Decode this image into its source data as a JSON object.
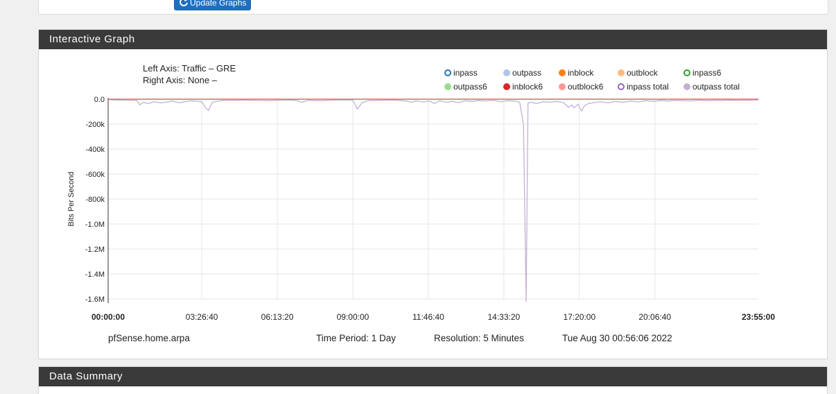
{
  "top_panel": {
    "update_button_label": "Update Graphs"
  },
  "graph_panel": {
    "title": "Interactive Graph",
    "left_axis_text": "Left Axis: Traffic – GRE",
    "right_axis_text": "Right Axis: None –",
    "legend": [
      {
        "label": "inpass",
        "color": "#1f77b4",
        "style": "hollow"
      },
      {
        "label": "outpass",
        "color": "#aec7e8",
        "style": "filled"
      },
      {
        "label": "inblock",
        "color": "#ff7f0e",
        "style": "filled"
      },
      {
        "label": "outblock",
        "color": "#ffbb78",
        "style": "filled"
      },
      {
        "label": "inpass6",
        "color": "#2ca02c",
        "style": "hollow"
      },
      {
        "label": "outpass6",
        "color": "#98df8a",
        "style": "filled"
      },
      {
        "label": "inblock6",
        "color": "#d62728",
        "style": "filled"
      },
      {
        "label": "outblock6",
        "color": "#ff9896",
        "style": "filled"
      },
      {
        "label": "inpass total",
        "color": "#9467bd",
        "style": "hollow"
      },
      {
        "label": "outpass total",
        "color": "#c5b0d5",
        "style": "filled"
      }
    ],
    "footer": {
      "host": "pfSense.home.arpa",
      "period": "Time Period: 1 Day",
      "resolution": "Resolution: 5 Minutes",
      "timestamp": "Tue Aug 30 00:56:06 2022"
    }
  },
  "summary_panel": {
    "title": "Data Summary"
  },
  "chart_data": {
    "type": "line",
    "ylabel": "Bits Per Second",
    "y_ticks": [
      {
        "value": 0,
        "label": "0.0"
      },
      {
        "value": -200000,
        "label": "-200k"
      },
      {
        "value": -400000,
        "label": "-400k"
      },
      {
        "value": -600000,
        "label": "-600k"
      },
      {
        "value": -800000,
        "label": "-800k"
      },
      {
        "value": -1000000,
        "label": "-1.0M"
      },
      {
        "value": -1200000,
        "label": "-1.2M"
      },
      {
        "value": -1400000,
        "label": "-1.4M"
      },
      {
        "value": -1600000,
        "label": "-1.6M"
      }
    ],
    "ylim": [
      -1600000,
      0
    ],
    "x_ticks": [
      {
        "value": 0,
        "label": "00:00:00",
        "bold": true
      },
      {
        "value": 12400,
        "label": "03:26:40",
        "bold": false
      },
      {
        "value": 22400,
        "label": "06:13:20",
        "bold": false
      },
      {
        "value": 32400,
        "label": "09:00:00",
        "bold": false
      },
      {
        "value": 42400,
        "label": "11:46:40",
        "bold": false
      },
      {
        "value": 52400,
        "label": "14:33:20",
        "bold": false
      },
      {
        "value": 62400,
        "label": "17:20:00",
        "bold": false
      },
      {
        "value": 72400,
        "label": "20:06:40",
        "bold": false
      },
      {
        "value": 86100,
        "label": "23:55:00",
        "bold": true
      }
    ],
    "xlim": [
      0,
      86100
    ],
    "grid": true,
    "series": [
      {
        "name": "inpass total",
        "color": "#e06666",
        "x": [
          0,
          86100
        ],
        "y": [
          0,
          0
        ]
      },
      {
        "name": "outpass total",
        "color": "#c5b0d5",
        "x": [
          0,
          2000,
          3800,
          4200,
          4700,
          5300,
          6100,
          7000,
          8500,
          9400,
          11000,
          12400,
          12900,
          13300,
          13800,
          15000,
          18000,
          21000,
          24000,
          25000,
          25600,
          26500,
          28000,
          30000,
          32400,
          33000,
          33600,
          34400,
          36000,
          38000,
          39500,
          40200,
          40800,
          41600,
          42600,
          43200,
          43900,
          44800,
          45600,
          46400,
          47300,
          48200,
          49000,
          50000,
          51000,
          52000,
          53000,
          54000,
          54500,
          55000,
          55350,
          55600,
          56000,
          56800,
          57600,
          58500,
          59400,
          60300,
          61000,
          61400,
          61700,
          62200,
          62700,
          63100,
          63600,
          64300,
          65200,
          66200,
          67200,
          68200,
          69200,
          70200,
          71200,
          72200,
          73200,
          74200,
          75200,
          76200,
          77200,
          78200,
          79200,
          80200,
          81200,
          82200,
          83200,
          84200,
          85200,
          86100
        ],
        "y": [
          -5000,
          -8000,
          -10000,
          -45000,
          -25000,
          -35000,
          -20000,
          -30000,
          -15000,
          -28000,
          -12000,
          -20000,
          -70000,
          -90000,
          -25000,
          -10000,
          -8000,
          -12000,
          -6000,
          -10000,
          -25000,
          -9000,
          -12000,
          -8000,
          -6000,
          -80000,
          -30000,
          -12000,
          -9000,
          -7000,
          -15000,
          -25000,
          -12000,
          -22000,
          -15000,
          -35000,
          -12000,
          -25000,
          -18000,
          -28000,
          -12000,
          -18000,
          -10000,
          -14000,
          -9000,
          -20000,
          -12000,
          -15000,
          -25000,
          -200000,
          -1650000,
          -30000,
          -25000,
          -35000,
          -20000,
          -25000,
          -18000,
          -28000,
          -65000,
          -45000,
          -70000,
          -40000,
          -95000,
          -50000,
          -35000,
          -28000,
          -20000,
          -30000,
          -18000,
          -25000,
          -15000,
          -22000,
          -12000,
          -18000,
          -10000,
          -15000,
          -9000,
          -12000,
          -14000,
          -8000,
          -12000,
          -9000,
          -11000,
          -7000,
          -10000,
          -8000,
          -9000,
          -6000
        ]
      }
    ]
  }
}
